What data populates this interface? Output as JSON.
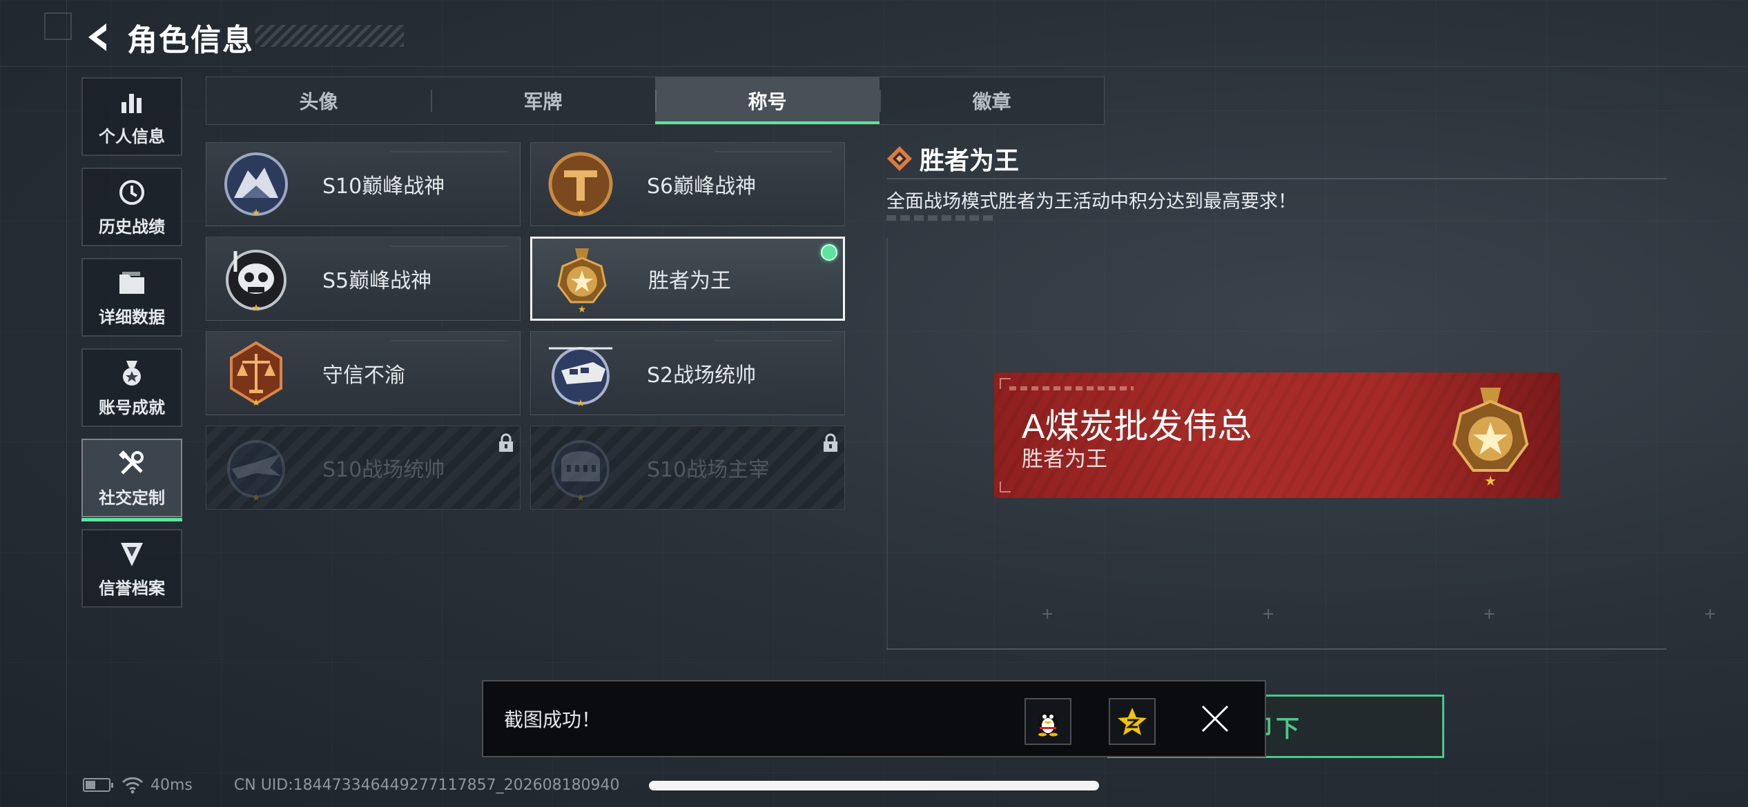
{
  "header": {
    "title": "角色信息",
    "back_icon": "back-arrow-icon"
  },
  "sidebar": {
    "items": [
      {
        "label": "个人信息",
        "icon": "bar-chart-icon",
        "active": false
      },
      {
        "label": "历史战绩",
        "icon": "history-clock-icon",
        "active": false
      },
      {
        "label": "详细数据",
        "icon": "folder-icon",
        "active": false
      },
      {
        "label": "账号成就",
        "icon": "achievement-medal-icon",
        "active": false
      },
      {
        "label": "社交定制",
        "icon": "tools-icon",
        "active": true
      },
      {
        "label": "信誉档案",
        "icon": "shield-emblem-icon",
        "active": false
      }
    ]
  },
  "tabs": [
    {
      "label": "头像",
      "active": false
    },
    {
      "label": "军牌",
      "active": false
    },
    {
      "label": "称号",
      "active": true
    },
    {
      "label": "徽章",
      "active": false
    }
  ],
  "titles": [
    {
      "label": "S10巅峰战神",
      "badge": "mountain-fortress-badge",
      "locked": false,
      "selected": false
    },
    {
      "label": "S6巅峰战神",
      "badge": "bronze-t-badge",
      "locked": false,
      "selected": false
    },
    {
      "label": "S5巅峰战神",
      "badge": "skull-diver-badge",
      "locked": false,
      "selected": false
    },
    {
      "label": "胜者为王",
      "badge": "gold-star-medal-badge",
      "locked": false,
      "selected": true,
      "equipped": true
    },
    {
      "label": "守信不渝",
      "badge": "scales-of-justice-badge",
      "locked": false,
      "selected": false
    },
    {
      "label": "S2战场统帅",
      "badge": "helicopter-badge",
      "locked": false,
      "selected": false
    },
    {
      "label": "S10战场统帅",
      "badge": "jet-badge",
      "locked": true,
      "selected": false
    },
    {
      "label": "S10战场主宰",
      "badge": "colosseum-badge",
      "locked": true,
      "selected": false
    }
  ],
  "detail": {
    "title": "胜者为王",
    "description": "全面战场模式胜者为王活动中积分达到最高要求！"
  },
  "nameplate": {
    "player_name": "A煤炭批发伟总",
    "title": "胜者为王",
    "color": "#a52a26"
  },
  "actions": {
    "unequip_label": "卸下"
  },
  "toast": {
    "message": "截图成功！",
    "share_targets": [
      "qq-penguin-icon",
      "qzone-star-icon"
    ]
  },
  "status_bar": {
    "ping": "40ms",
    "uid": "CN UID:1844733464492771178​57_202608180940"
  },
  "colors": {
    "accent": "#5de5a0",
    "nameplate_red": "#a52a26",
    "unequip_green": "#49c98a"
  }
}
